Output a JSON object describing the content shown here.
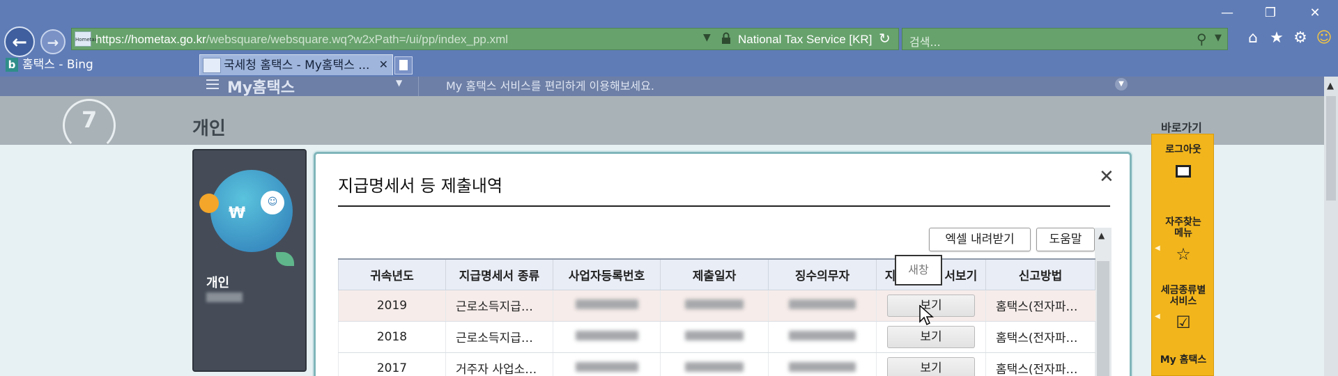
{
  "browser": {
    "url_prefix": "https://hometax.go.kr",
    "url_rest": "/websquare/websquare.wq?w2xPath=/ui/pp/index_pp.xml",
    "cert_label": "National Tax Service [KR]",
    "search_placeholder": "검색...",
    "site_icon_text": "Hometax",
    "tabs": [
      {
        "label": "홈택스 - Bing",
        "icon": "bing-icon",
        "active": false
      },
      {
        "label": "국세청 홈택스 - My홈택스 ...",
        "icon": "hometax-favicon",
        "active": true
      }
    ],
    "colors": {
      "chrome": "#5f7cb6",
      "address_bar": "#67a26c"
    }
  },
  "site": {
    "menu_label": "My홈택스",
    "notice": "My 홈택스 서비스를 편리하게 이용해보세요.",
    "logo_text": "7",
    "page_title": "개인",
    "profile": {
      "type": "개인"
    },
    "quick_menu": {
      "label": "바로가기",
      "items": [
        {
          "label": "로그아웃",
          "icon": "unlock-icon"
        },
        {
          "label": "자주찾는 메뉴",
          "icon": "star-icon"
        },
        {
          "label": "세금종류별 서비스",
          "icon": "checkbox-icon"
        },
        {
          "label": "My 홈택스",
          "icon": ""
        }
      ],
      "color": "#f2b51b"
    }
  },
  "modal": {
    "title": "지급명세서 등 제출내역",
    "excel_button": "엑셀 내려받기",
    "help_button": "도움말",
    "columns": [
      "귀속년도",
      "지급명세서 종류",
      "사업자등록번호",
      "제출일자",
      "징수의무자",
      "지급명세서보기",
      "신고방법"
    ],
    "header_view_prefix": "지",
    "header_view_suffix": "서보기",
    "tooltip": "새창",
    "view_label": "보기",
    "rows": [
      {
        "year": "2019",
        "kind": "근로소득지급…",
        "method": "홈택스(전자파…"
      },
      {
        "year": "2018",
        "kind": "근로소득지급…",
        "method": "홈택스(전자파…"
      },
      {
        "year": "2017",
        "kind": "거주자 사업소…",
        "method": "홈택스(전자파…"
      }
    ]
  }
}
